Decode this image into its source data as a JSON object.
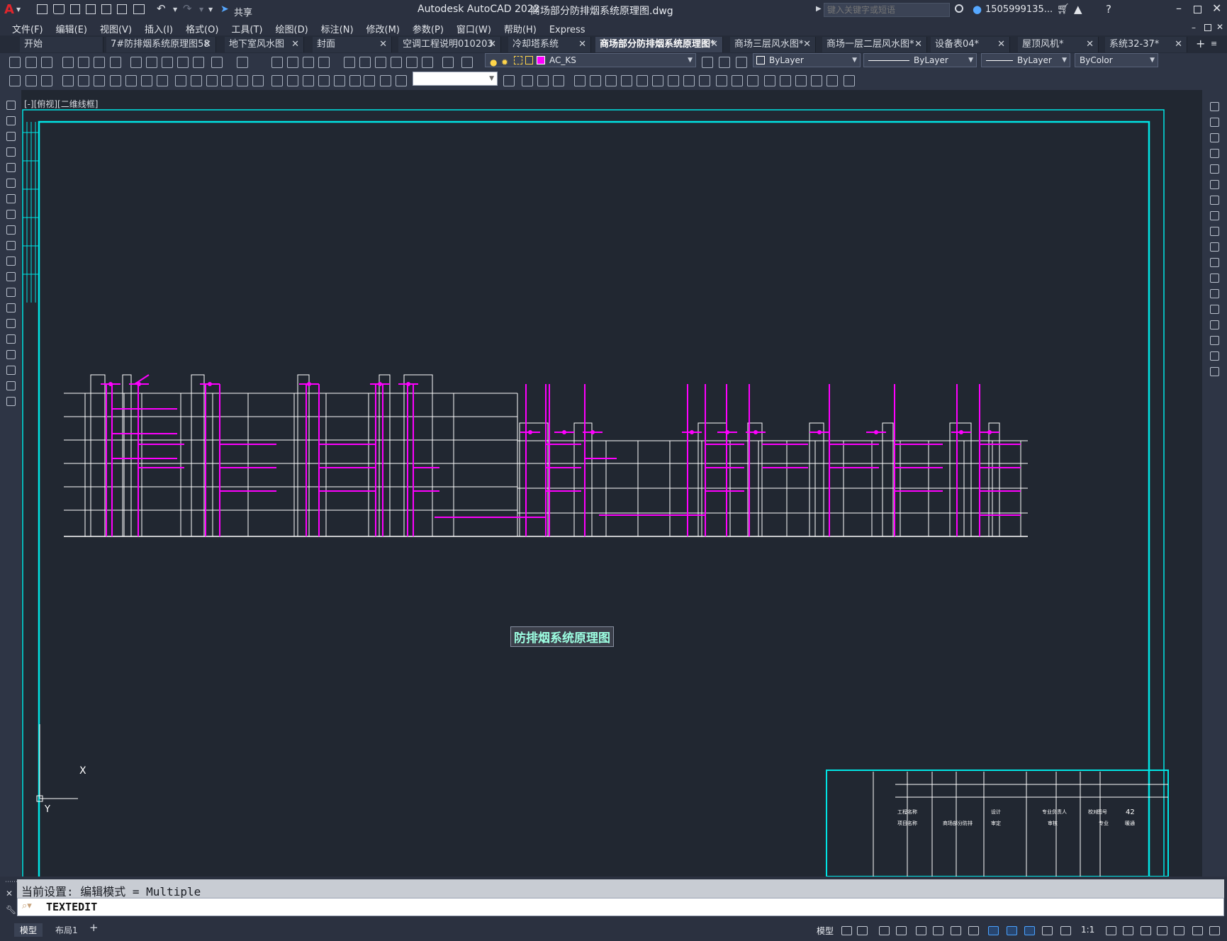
{
  "app": {
    "title": "Autodesk AutoCAD 2022",
    "filename": "商场部分防排烟系统原理图.dwg",
    "share_label": "共享",
    "search_placeholder": "键入关键字或短语",
    "user": "1505999135...",
    "logo": "A"
  },
  "menu": [
    "文件(F)",
    "编辑(E)",
    "视图(V)",
    "插入(I)",
    "格式(O)",
    "工具(T)",
    "绘图(D)",
    "标注(N)",
    "修改(M)",
    "参数(P)",
    "窗口(W)",
    "帮助(H)",
    "Express"
  ],
  "tabs": [
    {
      "label": "开始"
    },
    {
      "label": "7#防排烟系统原理图58"
    },
    {
      "label": "地下室风水图"
    },
    {
      "label": "封面"
    },
    {
      "label": "空调工程说明010203"
    },
    {
      "label": "冷却塔系统"
    },
    {
      "label": "商场部分防排烟系统原理图*"
    },
    {
      "label": "商场三层风水图*"
    },
    {
      "label": "商场一层二层风水图*"
    },
    {
      "label": "设备表04*"
    },
    {
      "label": "屋顶风机*"
    },
    {
      "label": "系统32-37*"
    }
  ],
  "layer": {
    "name": "AC_KS",
    "color": "#ff00ff"
  },
  "properties": {
    "color": "ByLayer",
    "linetype": "ByLayer",
    "lineweight": "ByLayer",
    "plotstyle": "ByColor"
  },
  "viewport_label": "[-][俯视][二维线框]",
  "drawing": {
    "title": "防排烟系统原理图",
    "sheet_number": "42",
    "titleblock": [
      "工程名称",
      "项目名称",
      "商场部分防排",
      "设计",
      "审定",
      "专业负责人",
      "审核",
      "校对",
      "图号",
      "专业",
      "暖通"
    ]
  },
  "ucs": {
    "x": "X",
    "y": "Y"
  },
  "command": {
    "history": "当前设置: 编辑模式 = Multiple",
    "current": "TEXTEDIT"
  },
  "layout_tabs": [
    "模型",
    "布局1"
  ],
  "status": {
    "space": "模型",
    "scale": "1:1"
  },
  "colors": {
    "accent": "#00e5e5",
    "entity": "#ff00ff",
    "line": "#ffffff",
    "background": "#212731"
  }
}
